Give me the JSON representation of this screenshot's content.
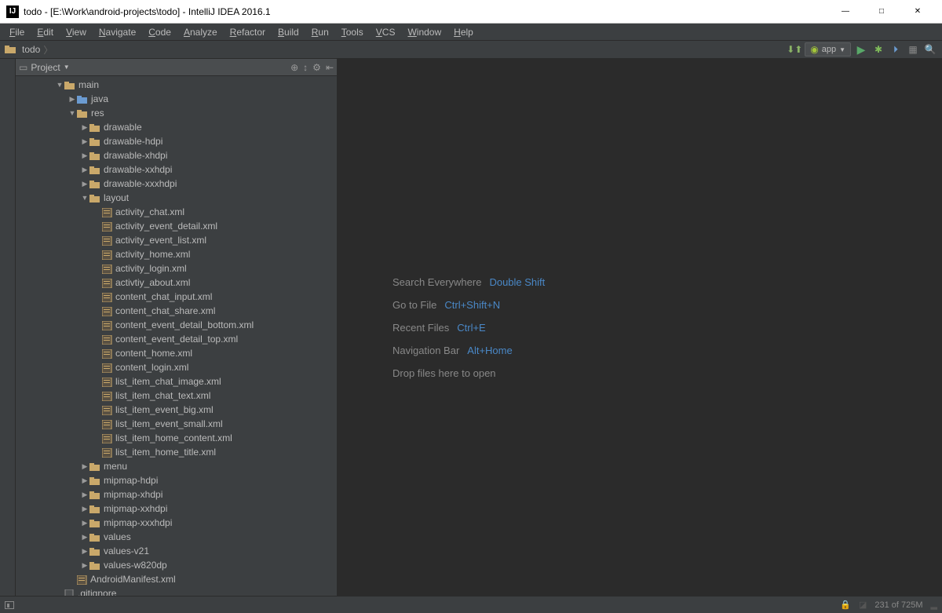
{
  "window": {
    "title": "todo - [E:\\Work\\android-projects\\todo] - IntelliJ IDEA 2016.1",
    "app_icon_text": "IJ"
  },
  "menu": [
    "File",
    "Edit",
    "View",
    "Navigate",
    "Code",
    "Analyze",
    "Refactor",
    "Build",
    "Run",
    "Tools",
    "VCS",
    "Window",
    "Help"
  ],
  "breadcrumb": {
    "item": "todo"
  },
  "run_config": {
    "label": "app"
  },
  "panel": {
    "title": "Project"
  },
  "tree": [
    {
      "depth": 2,
      "arrow": "down",
      "icon": "folder",
      "label": "main"
    },
    {
      "depth": 3,
      "arrow": "right",
      "icon": "folder-blue",
      "label": "java"
    },
    {
      "depth": 3,
      "arrow": "down",
      "icon": "folder-res",
      "label": "res"
    },
    {
      "depth": 4,
      "arrow": "right",
      "icon": "folder",
      "label": "drawable"
    },
    {
      "depth": 4,
      "arrow": "right",
      "icon": "folder",
      "label": "drawable-hdpi"
    },
    {
      "depth": 4,
      "arrow": "right",
      "icon": "folder",
      "label": "drawable-xhdpi"
    },
    {
      "depth": 4,
      "arrow": "right",
      "icon": "folder",
      "label": "drawable-xxhdpi"
    },
    {
      "depth": 4,
      "arrow": "right",
      "icon": "folder",
      "label": "drawable-xxxhdpi"
    },
    {
      "depth": 4,
      "arrow": "down",
      "icon": "folder",
      "label": "layout"
    },
    {
      "depth": 5,
      "arrow": "",
      "icon": "xml",
      "label": "activity_chat.xml"
    },
    {
      "depth": 5,
      "arrow": "",
      "icon": "xml",
      "label": "activity_event_detail.xml"
    },
    {
      "depth": 5,
      "arrow": "",
      "icon": "xml",
      "label": "activity_event_list.xml"
    },
    {
      "depth": 5,
      "arrow": "",
      "icon": "xml",
      "label": "activity_home.xml"
    },
    {
      "depth": 5,
      "arrow": "",
      "icon": "xml",
      "label": "activity_login.xml"
    },
    {
      "depth": 5,
      "arrow": "",
      "icon": "xml",
      "label": "activtiy_about.xml"
    },
    {
      "depth": 5,
      "arrow": "",
      "icon": "xml",
      "label": "content_chat_input.xml"
    },
    {
      "depth": 5,
      "arrow": "",
      "icon": "xml",
      "label": "content_chat_share.xml"
    },
    {
      "depth": 5,
      "arrow": "",
      "icon": "xml",
      "label": "content_event_detail_bottom.xml"
    },
    {
      "depth": 5,
      "arrow": "",
      "icon": "xml",
      "label": "content_event_detail_top.xml"
    },
    {
      "depth": 5,
      "arrow": "",
      "icon": "xml",
      "label": "content_home.xml"
    },
    {
      "depth": 5,
      "arrow": "",
      "icon": "xml",
      "label": "content_login.xml"
    },
    {
      "depth": 5,
      "arrow": "",
      "icon": "xml",
      "label": "list_item_chat_image.xml"
    },
    {
      "depth": 5,
      "arrow": "",
      "icon": "xml",
      "label": "list_item_chat_text.xml"
    },
    {
      "depth": 5,
      "arrow": "",
      "icon": "xml",
      "label": "list_item_event_big.xml"
    },
    {
      "depth": 5,
      "arrow": "",
      "icon": "xml",
      "label": "list_item_event_small.xml"
    },
    {
      "depth": 5,
      "arrow": "",
      "icon": "xml",
      "label": "list_item_home_content.xml"
    },
    {
      "depth": 5,
      "arrow": "",
      "icon": "xml",
      "label": "list_item_home_title.xml"
    },
    {
      "depth": 4,
      "arrow": "right",
      "icon": "folder",
      "label": "menu"
    },
    {
      "depth": 4,
      "arrow": "right",
      "icon": "folder",
      "label": "mipmap-hdpi"
    },
    {
      "depth": 4,
      "arrow": "right",
      "icon": "folder",
      "label": "mipmap-xhdpi"
    },
    {
      "depth": 4,
      "arrow": "right",
      "icon": "folder",
      "label": "mipmap-xxhdpi"
    },
    {
      "depth": 4,
      "arrow": "right",
      "icon": "folder",
      "label": "mipmap-xxxhdpi"
    },
    {
      "depth": 4,
      "arrow": "right",
      "icon": "folder",
      "label": "values"
    },
    {
      "depth": 4,
      "arrow": "right",
      "icon": "folder",
      "label": "values-v21"
    },
    {
      "depth": 4,
      "arrow": "right",
      "icon": "folder",
      "label": "values-w820dp"
    },
    {
      "depth": 3,
      "arrow": "",
      "icon": "xml",
      "label": "AndroidManifest.xml"
    },
    {
      "depth": 2,
      "arrow": "",
      "icon": "file",
      "label": ".gitignore"
    }
  ],
  "hints": [
    {
      "label": "Search Everywhere",
      "key": "Double Shift"
    },
    {
      "label": "Go to File",
      "key": "Ctrl+Shift+N"
    },
    {
      "label": "Recent Files",
      "key": "Ctrl+E"
    },
    {
      "label": "Navigation Bar",
      "key": "Alt+Home"
    },
    {
      "label": "Drop files here to open",
      "key": ""
    }
  ],
  "status": {
    "memory": "231 of 725M"
  }
}
